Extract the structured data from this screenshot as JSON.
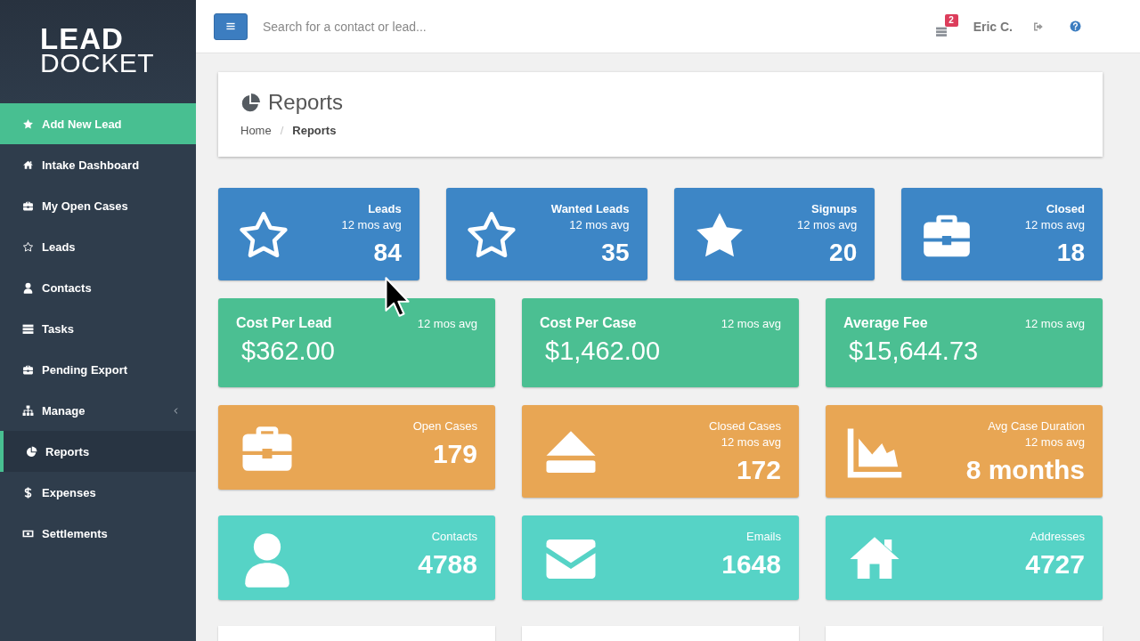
{
  "sidebar": {
    "logo": {
      "top": "LEAD",
      "bottom": "DOCKET"
    },
    "items": [
      {
        "label": "Add New Lead",
        "kind": "action",
        "selected": false
      },
      {
        "label": "Intake Dashboard",
        "kind": "link",
        "selected": false
      },
      {
        "label": "My Open Cases",
        "kind": "link",
        "selected": false
      },
      {
        "label": "Leads",
        "kind": "link",
        "selected": false
      },
      {
        "label": "Contacts",
        "kind": "link",
        "selected": false
      },
      {
        "label": "Tasks",
        "kind": "link",
        "selected": false
      },
      {
        "label": "Pending Export",
        "kind": "link",
        "selected": false
      },
      {
        "label": "Manage",
        "kind": "group",
        "expanded": false,
        "selected": false
      },
      {
        "label": "Reports",
        "kind": "link",
        "selected": true
      },
      {
        "label": "Expenses",
        "kind": "link",
        "selected": false
      },
      {
        "label": "Settlements",
        "kind": "link",
        "selected": false
      }
    ]
  },
  "topbar": {
    "search": {
      "placeholder": "Search for a contact or lead..."
    },
    "tasks_badge": "2",
    "user": "Eric C."
  },
  "page_header": {
    "title": "Reports",
    "breadcrumb": [
      {
        "label": "Home",
        "selected": false
      },
      {
        "label": "Reports",
        "selected": true
      }
    ],
    "breadcrumb_separator": "/"
  },
  "stat_rows": [
    {
      "kind": "count",
      "color": "#3d86c6",
      "cards": [
        {
          "title": "Leads",
          "note": "12 mos avg",
          "value": "84"
        },
        {
          "title": "Wanted Leads",
          "note": "12 mos avg",
          "value": "35"
        },
        {
          "title": "Signups",
          "note": "12 mos avg",
          "value": "20"
        },
        {
          "title": "Closed",
          "note": "12 mos avg",
          "value": "18"
        }
      ]
    },
    {
      "kind": "amount",
      "color": "#4bbf92",
      "cards": [
        {
          "title": "Cost Per Lead",
          "note": "12 mos avg",
          "value": "$362.00"
        },
        {
          "title": "Cost Per Case",
          "note": "12 mos avg",
          "value": "$1,462.00"
        },
        {
          "title": "Average Fee",
          "note": "12 mos avg",
          "value": "$15,644.73"
        }
      ]
    },
    {
      "kind": "tally",
      "color": "#e8a654",
      "cards": [
        {
          "title": "Open Cases",
          "value": "179"
        },
        {
          "title": "Closed Cases",
          "note": "12 mos avg",
          "value": "172"
        },
        {
          "title": "Avg Case Duration",
          "note": "12 mos avg",
          "value": "8 months"
        }
      ]
    },
    {
      "kind": "tally",
      "color": "#56d3c6",
      "cards": [
        {
          "title": "Contacts",
          "value": "4788"
        },
        {
          "title": "Emails",
          "value": "1648"
        },
        {
          "title": "Addresses",
          "value": "4727"
        }
      ]
    }
  ]
}
